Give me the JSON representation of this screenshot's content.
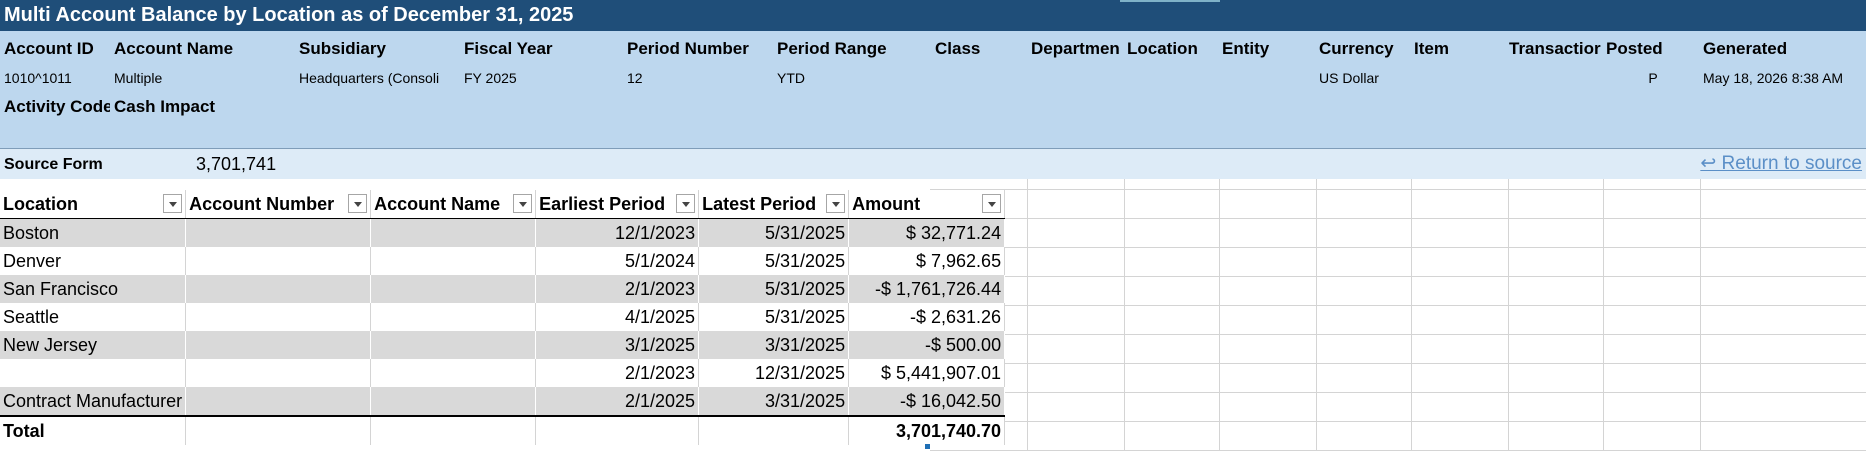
{
  "title": "Multi Account Balance by Location as of December 31, 2025",
  "header_labels": {
    "account_id": "Account ID",
    "account_name": "Account Name",
    "subsidiary": "Subsidiary",
    "fiscal_year": "Fiscal Year",
    "period_number": "Period Number",
    "period_range": "Period Range",
    "class": "Class",
    "department": "Departmen",
    "location": "Location",
    "entity": "Entity",
    "currency": "Currency",
    "item": "Item",
    "transaction": "Transactior",
    "posted": "Posted",
    "generated": "Generated"
  },
  "header_values": {
    "account_id": "1010^1011",
    "account_name": "Multiple",
    "subsidiary": "Headquarters (Consoli",
    "fiscal_year": "FY 2025",
    "period_number": "12",
    "period_range": "YTD",
    "currency": "US Dollar",
    "posted": "P",
    "generated": "May 18, 2026 8:38 AM"
  },
  "activity_labels": {
    "activity_code": "Activity Code",
    "cash_impact": "Cash Impact"
  },
  "source": {
    "label": "Source Form",
    "value": "3,701,741",
    "return_link": "↩ Return to source"
  },
  "table": {
    "columns": [
      "Location",
      "Account Number",
      "Account Name",
      "Earliest Period",
      "Latest Period",
      "Amount"
    ],
    "rows": [
      {
        "location": "Boston",
        "account_number": "",
        "account_name": "",
        "earliest": "12/1/2023",
        "latest": "5/31/2025",
        "amount": "$ 32,771.24"
      },
      {
        "location": "Denver",
        "account_number": "",
        "account_name": "",
        "earliest": "5/1/2024",
        "latest": "5/31/2025",
        "amount": "$ 7,962.65"
      },
      {
        "location": "San Francisco",
        "account_number": "",
        "account_name": "",
        "earliest": "2/1/2023",
        "latest": "5/31/2025",
        "amount": "-$ 1,761,726.44"
      },
      {
        "location": "Seattle",
        "account_number": "",
        "account_name": "",
        "earliest": "4/1/2025",
        "latest": "5/31/2025",
        "amount": "-$ 2,631.26"
      },
      {
        "location": "New Jersey",
        "account_number": "",
        "account_name": "",
        "earliest": "3/1/2025",
        "latest": "3/31/2025",
        "amount": "-$ 500.00"
      },
      {
        "location": "",
        "account_number": "",
        "account_name": "",
        "earliest": "2/1/2023",
        "latest": "12/31/2025",
        "amount": "$ 5,441,907.01"
      },
      {
        "location": "Contract Manufacturer",
        "account_number": "",
        "account_name": "",
        "earliest": "2/1/2025",
        "latest": "3/31/2025",
        "amount": "-$ 16,042.50"
      }
    ],
    "total": {
      "label": "Total",
      "amount": "3,701,740.70"
    }
  }
}
